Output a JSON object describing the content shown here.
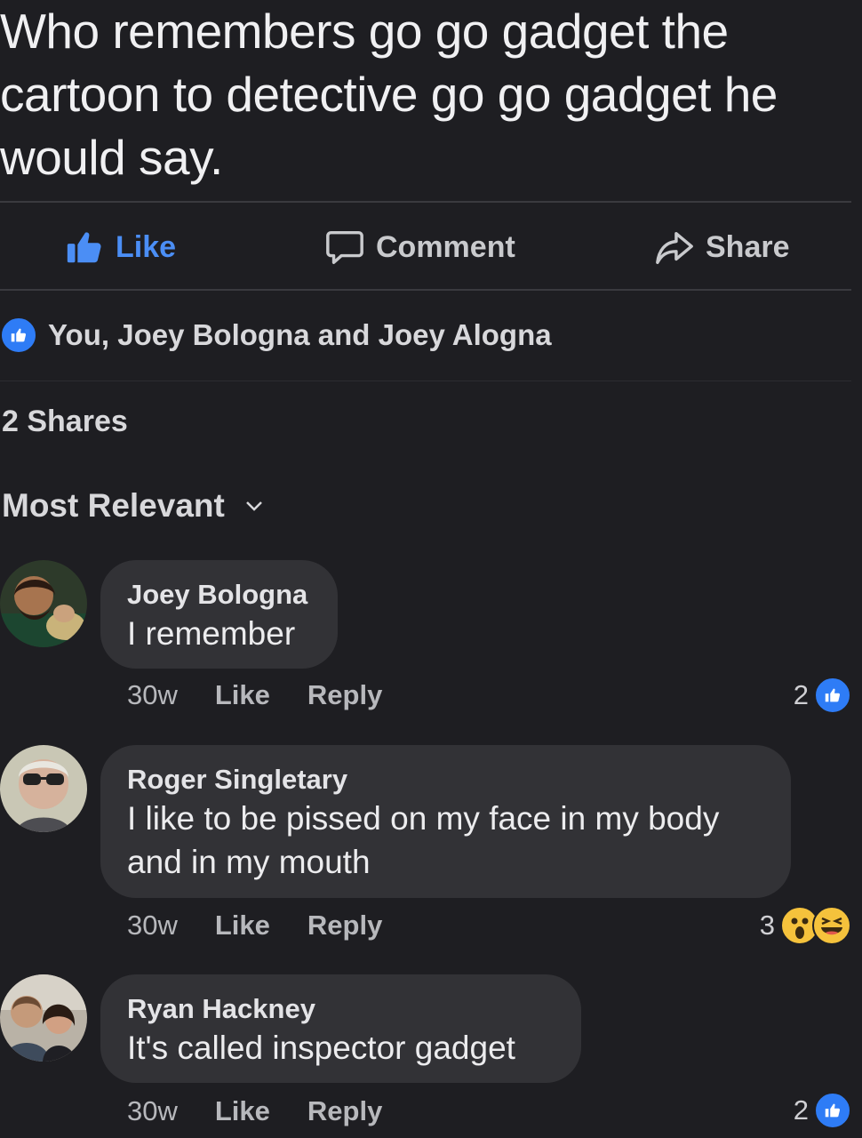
{
  "post": {
    "lines": [
      "Who remembers go go gadget the",
      "cartoon to detective go go gadget he",
      "would say."
    ]
  },
  "actions": {
    "like": "Like",
    "comment": "Comment",
    "share": "Share"
  },
  "reactions_summary": "You, Joey Bologna and Joey Alogna",
  "shares": "2 Shares",
  "sort_label": "Most Relevant",
  "comments": [
    {
      "author": "Joey Bologna",
      "body": "I remember",
      "time": "30w",
      "like": "Like",
      "reply": "Reply",
      "reaction_count": "2",
      "reactions": [
        "like-icon"
      ]
    },
    {
      "author": "Roger Singletary",
      "body_lines": [
        "I like to be pissed on my face in my body",
        "and in my mouth"
      ],
      "time": "30w",
      "like": "Like",
      "reply": "Reply",
      "reaction_count": "3",
      "reactions": [
        "wow-icon",
        "haha-icon"
      ]
    },
    {
      "author": "Ryan Hackney",
      "body": "It's called inspector gadget",
      "time": "30w",
      "like": "Like",
      "reply": "Reply",
      "reaction_count": "2",
      "reactions": [
        "like-icon"
      ]
    }
  ],
  "colors": {
    "background": "#1e1e22",
    "bubble": "#323236",
    "accent_blue": "#2e7cf6",
    "like_text": "#4b8ef5"
  }
}
